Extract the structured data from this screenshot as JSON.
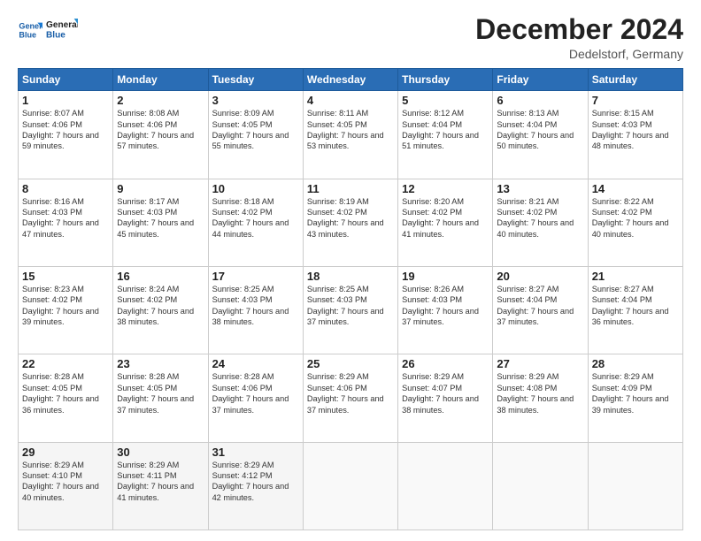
{
  "logo": {
    "line1": "General",
    "line2": "Blue"
  },
  "title": "December 2024",
  "location": "Dedelstorf, Germany",
  "days": [
    "Sunday",
    "Monday",
    "Tuesday",
    "Wednesday",
    "Thursday",
    "Friday",
    "Saturday"
  ],
  "weeks": [
    [
      {
        "num": "1",
        "sunrise": "8:07 AM",
        "sunset": "4:06 PM",
        "daylight": "7 hours and 59 minutes."
      },
      {
        "num": "2",
        "sunrise": "8:08 AM",
        "sunset": "4:06 PM",
        "daylight": "7 hours and 57 minutes."
      },
      {
        "num": "3",
        "sunrise": "8:09 AM",
        "sunset": "4:05 PM",
        "daylight": "7 hours and 55 minutes."
      },
      {
        "num": "4",
        "sunrise": "8:11 AM",
        "sunset": "4:05 PM",
        "daylight": "7 hours and 53 minutes."
      },
      {
        "num": "5",
        "sunrise": "8:12 AM",
        "sunset": "4:04 PM",
        "daylight": "7 hours and 51 minutes."
      },
      {
        "num": "6",
        "sunrise": "8:13 AM",
        "sunset": "4:04 PM",
        "daylight": "7 hours and 50 minutes."
      },
      {
        "num": "7",
        "sunrise": "8:15 AM",
        "sunset": "4:03 PM",
        "daylight": "7 hours and 48 minutes."
      }
    ],
    [
      {
        "num": "8",
        "sunrise": "8:16 AM",
        "sunset": "4:03 PM",
        "daylight": "7 hours and 47 minutes."
      },
      {
        "num": "9",
        "sunrise": "8:17 AM",
        "sunset": "4:03 PM",
        "daylight": "7 hours and 45 minutes."
      },
      {
        "num": "10",
        "sunrise": "8:18 AM",
        "sunset": "4:02 PM",
        "daylight": "7 hours and 44 minutes."
      },
      {
        "num": "11",
        "sunrise": "8:19 AM",
        "sunset": "4:02 PM",
        "daylight": "7 hours and 43 minutes."
      },
      {
        "num": "12",
        "sunrise": "8:20 AM",
        "sunset": "4:02 PM",
        "daylight": "7 hours and 41 minutes."
      },
      {
        "num": "13",
        "sunrise": "8:21 AM",
        "sunset": "4:02 PM",
        "daylight": "7 hours and 40 minutes."
      },
      {
        "num": "14",
        "sunrise": "8:22 AM",
        "sunset": "4:02 PM",
        "daylight": "7 hours and 40 minutes."
      }
    ],
    [
      {
        "num": "15",
        "sunrise": "8:23 AM",
        "sunset": "4:02 PM",
        "daylight": "7 hours and 39 minutes."
      },
      {
        "num": "16",
        "sunrise": "8:24 AM",
        "sunset": "4:02 PM",
        "daylight": "7 hours and 38 minutes."
      },
      {
        "num": "17",
        "sunrise": "8:25 AM",
        "sunset": "4:03 PM",
        "daylight": "7 hours and 38 minutes."
      },
      {
        "num": "18",
        "sunrise": "8:25 AM",
        "sunset": "4:03 PM",
        "daylight": "7 hours and 37 minutes."
      },
      {
        "num": "19",
        "sunrise": "8:26 AM",
        "sunset": "4:03 PM",
        "daylight": "7 hours and 37 minutes."
      },
      {
        "num": "20",
        "sunrise": "8:27 AM",
        "sunset": "4:04 PM",
        "daylight": "7 hours and 37 minutes."
      },
      {
        "num": "21",
        "sunrise": "8:27 AM",
        "sunset": "4:04 PM",
        "daylight": "7 hours and 36 minutes."
      }
    ],
    [
      {
        "num": "22",
        "sunrise": "8:28 AM",
        "sunset": "4:05 PM",
        "daylight": "7 hours and 36 minutes."
      },
      {
        "num": "23",
        "sunrise": "8:28 AM",
        "sunset": "4:05 PM",
        "daylight": "7 hours and 37 minutes."
      },
      {
        "num": "24",
        "sunrise": "8:28 AM",
        "sunset": "4:06 PM",
        "daylight": "7 hours and 37 minutes."
      },
      {
        "num": "25",
        "sunrise": "8:29 AM",
        "sunset": "4:06 PM",
        "daylight": "7 hours and 37 minutes."
      },
      {
        "num": "26",
        "sunrise": "8:29 AM",
        "sunset": "4:07 PM",
        "daylight": "7 hours and 38 minutes."
      },
      {
        "num": "27",
        "sunrise": "8:29 AM",
        "sunset": "4:08 PM",
        "daylight": "7 hours and 38 minutes."
      },
      {
        "num": "28",
        "sunrise": "8:29 AM",
        "sunset": "4:09 PM",
        "daylight": "7 hours and 39 minutes."
      }
    ],
    [
      {
        "num": "29",
        "sunrise": "8:29 AM",
        "sunset": "4:10 PM",
        "daylight": "7 hours and 40 minutes."
      },
      {
        "num": "30",
        "sunrise": "8:29 AM",
        "sunset": "4:11 PM",
        "daylight": "7 hours and 41 minutes."
      },
      {
        "num": "31",
        "sunrise": "8:29 AM",
        "sunset": "4:12 PM",
        "daylight": "7 hours and 42 minutes."
      },
      null,
      null,
      null,
      null
    ]
  ],
  "labels": {
    "sunrise": "Sunrise:",
    "sunset": "Sunset:",
    "daylight": "Daylight:"
  }
}
